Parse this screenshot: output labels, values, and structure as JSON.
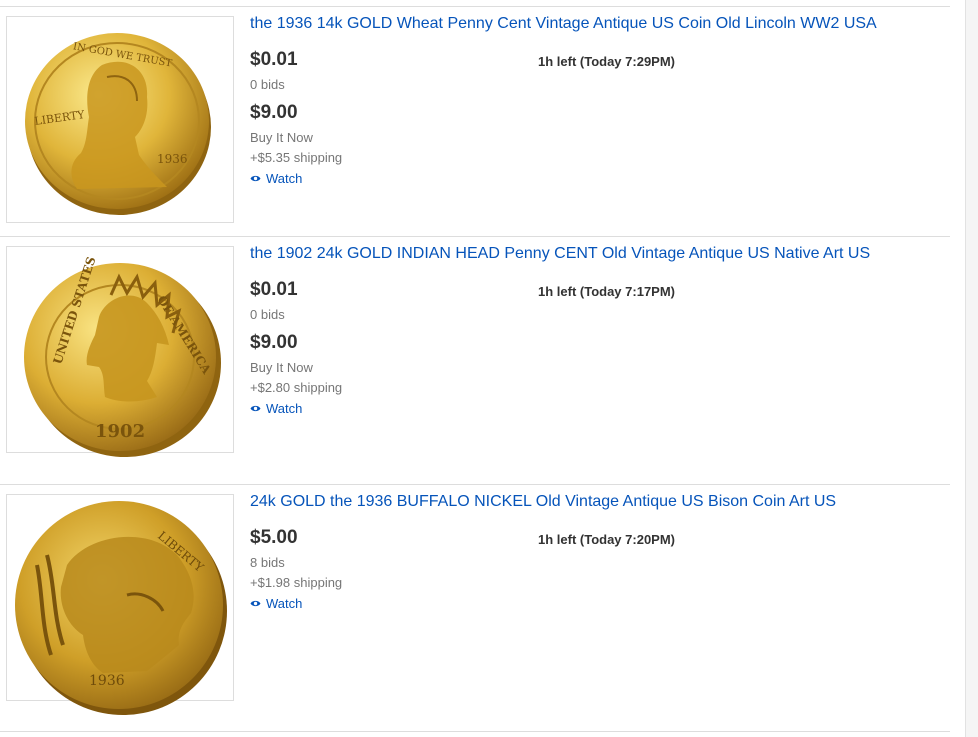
{
  "listings": [
    {
      "title": "the 1936 14k GOLD Wheat Penny Cent Vintage Antique US Coin Old Lincoln WW2 USA",
      "auction_price": "$0.01",
      "bids": "0 bids",
      "bin_price": "$9.00",
      "bin_label": "Buy It Now",
      "shipping": "+$5.35 shipping",
      "time_left": "1h left (Today 7:29PM)",
      "watch": "Watch",
      "image_icon": "lincoln-wheat-penny-coin",
      "coin_rim": "LIBERTY  1936"
    },
    {
      "title": "the 1902 24k GOLD INDIAN HEAD Penny CENT Old Vintage Antique US Native Art US",
      "auction_price": "$0.01",
      "bids": "0 bids",
      "bin_price": "$9.00",
      "bin_label": "Buy It Now",
      "shipping": "+$2.80 shipping",
      "time_left": "1h left (Today 7:17PM)",
      "watch": "Watch",
      "image_icon": "indian-head-penny-coin",
      "coin_rim": "UNITED STATES OF AMERICA",
      "coin_year": "1902"
    },
    {
      "title": "24k GOLD the 1936 BUFFALO NICKEL Old Vintage Antique US Bison Coin Art US",
      "auction_price": "$5.00",
      "bids": "8 bids",
      "shipping": "+$1.98 shipping",
      "time_left": "1h left (Today 7:20PM)",
      "watch": "Watch",
      "image_icon": "buffalo-nickel-coin"
    }
  ],
  "colors": {
    "link": "#0654ba",
    "price": "#333333",
    "meta": "#767676",
    "gold_light": "#f6dc6a",
    "gold_mid": "#d7a92a",
    "gold_dark": "#8f6410"
  }
}
